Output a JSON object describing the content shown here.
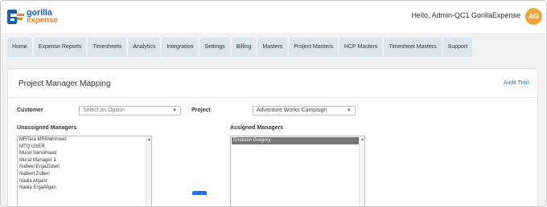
{
  "header": {
    "logo_line1": "gorilla",
    "logo_line2": "expense",
    "greeting": "Hello, Admin-QC1 GorillaExpense",
    "avatar_initials": "AG",
    "avatar_color": "#f2a33a"
  },
  "nav": {
    "tabs": [
      {
        "label": "Home"
      },
      {
        "label": "Expense Reports"
      },
      {
        "label": "Timesheets"
      },
      {
        "label": "Analytics"
      },
      {
        "label": "Integration"
      },
      {
        "label": "Settings"
      },
      {
        "label": "Billing"
      },
      {
        "label": "Masters"
      },
      {
        "label": "Project Masters"
      },
      {
        "label": "HCP Masters"
      },
      {
        "label": "Timesheet Masters"
      },
      {
        "label": "Support"
      }
    ]
  },
  "page": {
    "title": "Project Manager Mapping",
    "audit_trail": "Audit Trail"
  },
  "filters": {
    "customer_label": "Customer",
    "customer_placeholder": "Select an Option",
    "project_label": "Project",
    "project_value": "Adventure Works Campaign"
  },
  "unassigned": {
    "label": "Unassigned Managers",
    "items": [
      "MRTara MRMahmood",
      "MTQ USER",
      "Murat Sarslimaaz",
      "Murat Manager 1",
      "Nabeel ErgaZuberi",
      "Nabeel Zuberi",
      "Nadia Afganr",
      "Nadia ErgaAfgan"
    ]
  },
  "assigned": {
    "label": "Assigned Managers",
    "items": [
      "Erickson Gregory"
    ]
  },
  "colors": {
    "accent": "#2a6fd6",
    "brand_blue": "#1f5fa8",
    "brand_orange": "#f07f1e",
    "tab_bg": "#dde6ec"
  }
}
